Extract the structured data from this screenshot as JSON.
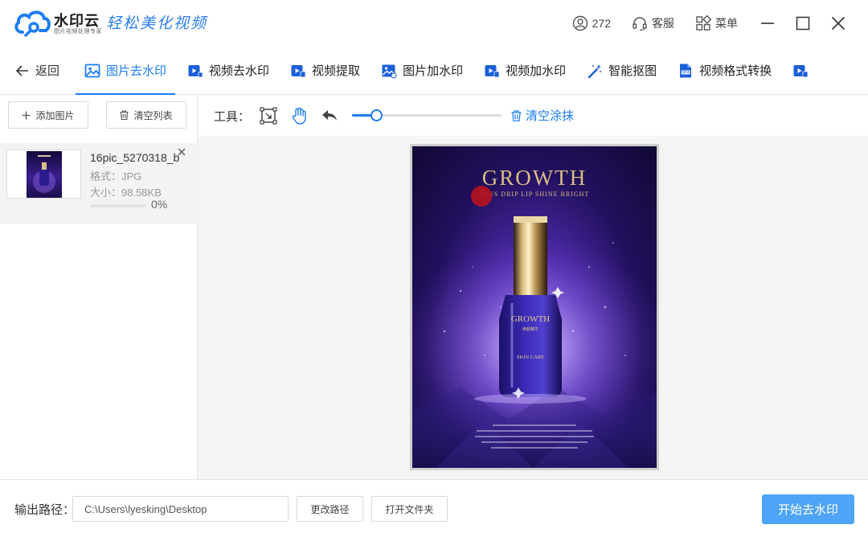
{
  "app": {
    "name": "水印云",
    "name_sub": "图片视频处理专家",
    "slogan": "轻松美化视频",
    "user_count": "272",
    "service_label": "客服",
    "menu_label": "菜单"
  },
  "nav": {
    "back_label": "返回",
    "tabs": [
      {
        "label": "图片去水印",
        "active": true
      },
      {
        "label": "视频去水印",
        "active": false
      },
      {
        "label": "视频提取",
        "active": false
      },
      {
        "label": "图片加水印",
        "active": false
      },
      {
        "label": "视频加水印",
        "active": false
      },
      {
        "label": "智能抠图",
        "active": false
      },
      {
        "label": "视频格式转换",
        "active": false
      }
    ]
  },
  "left_panel": {
    "add_image_label": "添加图片",
    "clear_list_label": "清空列表",
    "file": {
      "name": "16pic_5270318_b",
      "format": "格式：JPG",
      "size": "大小：98.58KB",
      "progress": 0,
      "progress_text": "0%"
    }
  },
  "toolbar": {
    "tools_label": "工具：",
    "brush_size": 0.16,
    "clear_brush_label": "清空涂抹"
  },
  "poster": {
    "title": "GROWTH",
    "subtitle": "PLUS DRIP LIP SHINE BRIGHT",
    "bottle_brand": "GROWTH",
    "bottle_sub": "焕颜精华",
    "bottle_line": "SKIN CARE"
  },
  "footer": {
    "output_label": "输出路径：",
    "output_path": "C:\\Users\\lyesking\\Desktop",
    "change_path_label": "更改路径",
    "open_folder_label": "打开文件夹",
    "start_label": "开始去水印"
  }
}
